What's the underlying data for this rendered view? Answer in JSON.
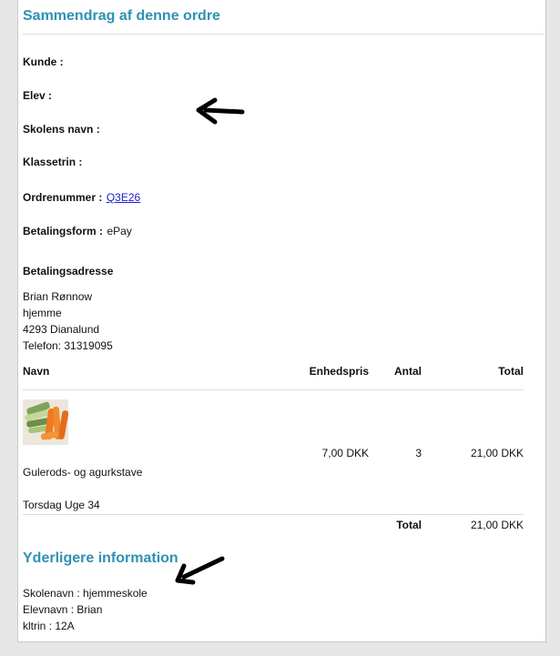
{
  "summary": {
    "title": "Sammendrag af denne ordre",
    "kunde_label": "Kunde :",
    "elev_label": "Elev :",
    "skole_label": "Skolens navn :",
    "klassetrin_label": "Klassetrin :",
    "ordrenummer_label": "Ordrenummer :",
    "ordrenummer_value": "Q3E26",
    "betalingsform_label": "Betalingsform :",
    "betalingsform_value": "ePay"
  },
  "billing": {
    "title": "Betalingsadresse",
    "name": "Brian Rønnow",
    "line1": "hjemme",
    "city": "4293 Dianalund",
    "phone": "Telefon: 31319095"
  },
  "table": {
    "headers": {
      "navn": "Navn",
      "enhedspris": "Enhedspris",
      "antal": "Antal",
      "total": "Total"
    },
    "item": {
      "unit_price": "7,00 DKK",
      "qty": "3",
      "line_total": "21,00 DKK",
      "name": "Gulerods- og agurkstave",
      "delivery": "Torsdag Uge 34"
    },
    "footer": {
      "total_label": "Total",
      "total_value": "21,00 DKK"
    }
  },
  "extra": {
    "title": "Yderligere information",
    "skolenavn": "Skolenavn : hjemmeskole",
    "elevnavn": "Elevnavn : Brian",
    "kltrin": "kltrin : 12A"
  },
  "colors": {
    "heading": "#2e91b4",
    "link": "#1a1ad6"
  }
}
